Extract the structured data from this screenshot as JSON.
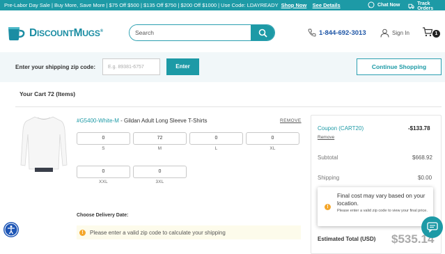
{
  "promo": {
    "text": "Pre-Labor Day Sale | Buy More, Save More | $75 Off $500 | $135 Off $750 | $200 Off $1000 | Use Code: LDAYREADY",
    "shop_now": "Shop Now",
    "see_details": "See Details",
    "chat_now": "Chat Now",
    "track_orders": "Track Orders"
  },
  "header": {
    "logo_text_big_1": "D",
    "logo_text_small_1": "ISCOUNT",
    "logo_text_big_2": "M",
    "logo_text_small_2": "UGS",
    "logo_reg": "®",
    "search_placeholder": "Search",
    "phone": "1-844-692-3013",
    "sign_in": "Sign In",
    "cart_count": "1"
  },
  "zip": {
    "label": "Enter your shipping zip code:",
    "placeholder": "E.g. 89381-6757",
    "enter_label": "Enter",
    "continue_label": "Continue Shopping"
  },
  "cart": {
    "title": "Your Cart 72 (Items)",
    "product_sku": "#G5400-White-M",
    "product_name": " - Gildan Adult Long Sleeve T-Shirts",
    "remove_label": "REMOVE",
    "sizes": [
      {
        "size": "S",
        "qty": "0"
      },
      {
        "size": "M",
        "qty": "72"
      },
      {
        "size": "L",
        "qty": "0"
      },
      {
        "size": "XL",
        "qty": "0"
      },
      {
        "size": "XXL",
        "qty": "0"
      },
      {
        "size": "3XL",
        "qty": "0"
      }
    ],
    "delivery_label": "Choose Delivery Date:",
    "zip_warning": "Please enter a valid zip code to calculate your shipping"
  },
  "summary": {
    "coupon_label": "Coupon (CART20)",
    "coupon_value": "-$133.78",
    "coupon_remove": "Remove",
    "subtotal_label": "Subtotal",
    "subtotal_value": "$668.92",
    "shipping_label": "Shipping",
    "shipping_value": "$0.00",
    "tooltip_title": "Final cost may vary based on your location.",
    "tooltip_body": "Please enter a valid zip code to view your final price.",
    "estimated_label": "Estimated Total (USD)",
    "estimated_value": "$535.14"
  },
  "colors": {
    "accent": "#1d9aa6",
    "phone": "#1d55a6",
    "warning": "#f4a62a"
  },
  "icons": [
    "chat-icon",
    "truck-icon",
    "mug-logo-icon",
    "search-icon",
    "phone-icon",
    "user-icon",
    "cart-icon",
    "warning-icon",
    "accessibility-icon",
    "chat-bubble-icon"
  ]
}
